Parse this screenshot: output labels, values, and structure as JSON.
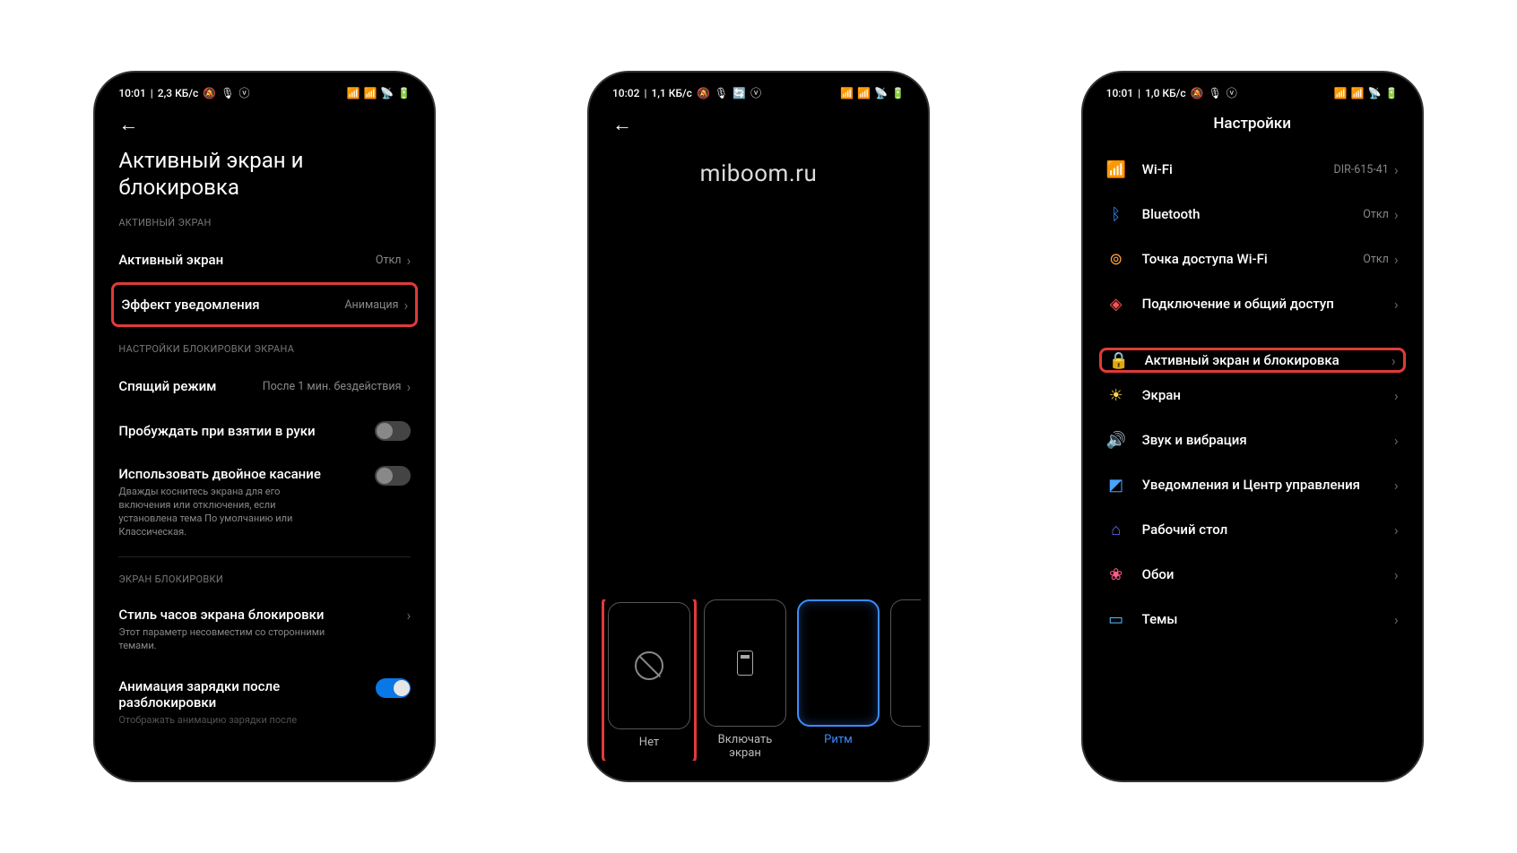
{
  "watermark": "miboom.ru",
  "phone1": {
    "status": {
      "time": "10:01",
      "speed": "2,3 КБ/с"
    },
    "title": "Активный экран и блокировка",
    "section1_label": "АКТИВНЫЙ ЭКРАН",
    "active_screen": {
      "label": "Активный экран",
      "value": "Откл"
    },
    "notif_effect": {
      "label": "Эффект уведомления",
      "value": "Анимация"
    },
    "section2_label": "НАСТРОЙКИ БЛОКИРОВКИ ЭКРАНА",
    "sleep": {
      "label": "Спящий режим",
      "value": "После 1 мин. бездействия"
    },
    "lift_wake": {
      "label": "Пробуждать при взятии в руки"
    },
    "double_tap": {
      "label": "Использовать двойное касание",
      "subtitle": "Дважды коснитесь экрана для его включения или отключения, если установлена тема По умолчанию или Классическая."
    },
    "section3_label": "ЭКРАН БЛОКИРОВКИ",
    "clock_style": {
      "label": "Стиль часов экрана блокировки",
      "subtitle": "Этот параметр несовместим со сторонними темами."
    },
    "charge_anim": {
      "label": "Анимация зарядки после разблокировки",
      "subtitle": "Отображать анимацию зарядки после"
    }
  },
  "phone2": {
    "status": {
      "time": "10:02",
      "speed": "1,1 КБ/с"
    },
    "tiles": [
      {
        "label": "Нет"
      },
      {
        "label": "Включать экран"
      },
      {
        "label": "Ритм"
      }
    ]
  },
  "phone3": {
    "status": {
      "time": "10:01",
      "speed": "1,0 КБ/с"
    },
    "title": "Настройки",
    "wifi": {
      "label": "Wi-Fi",
      "value": "DIR-615-41"
    },
    "bluetooth": {
      "label": "Bluetooth",
      "value": "Откл"
    },
    "hotspot": {
      "label": "Точка доступа Wi-Fi",
      "value": "Откл"
    },
    "share": {
      "label": "Подключение и общий доступ"
    },
    "aod": {
      "label": "Активный экран и блокировка"
    },
    "display": {
      "label": "Экран"
    },
    "sound": {
      "label": "Звук и вибрация"
    },
    "notifications": {
      "label": "Уведомления и Центр управления"
    },
    "desktop": {
      "label": "Рабочий стол"
    },
    "wallpaper": {
      "label": "Обои"
    },
    "themes": {
      "label": "Темы"
    }
  }
}
